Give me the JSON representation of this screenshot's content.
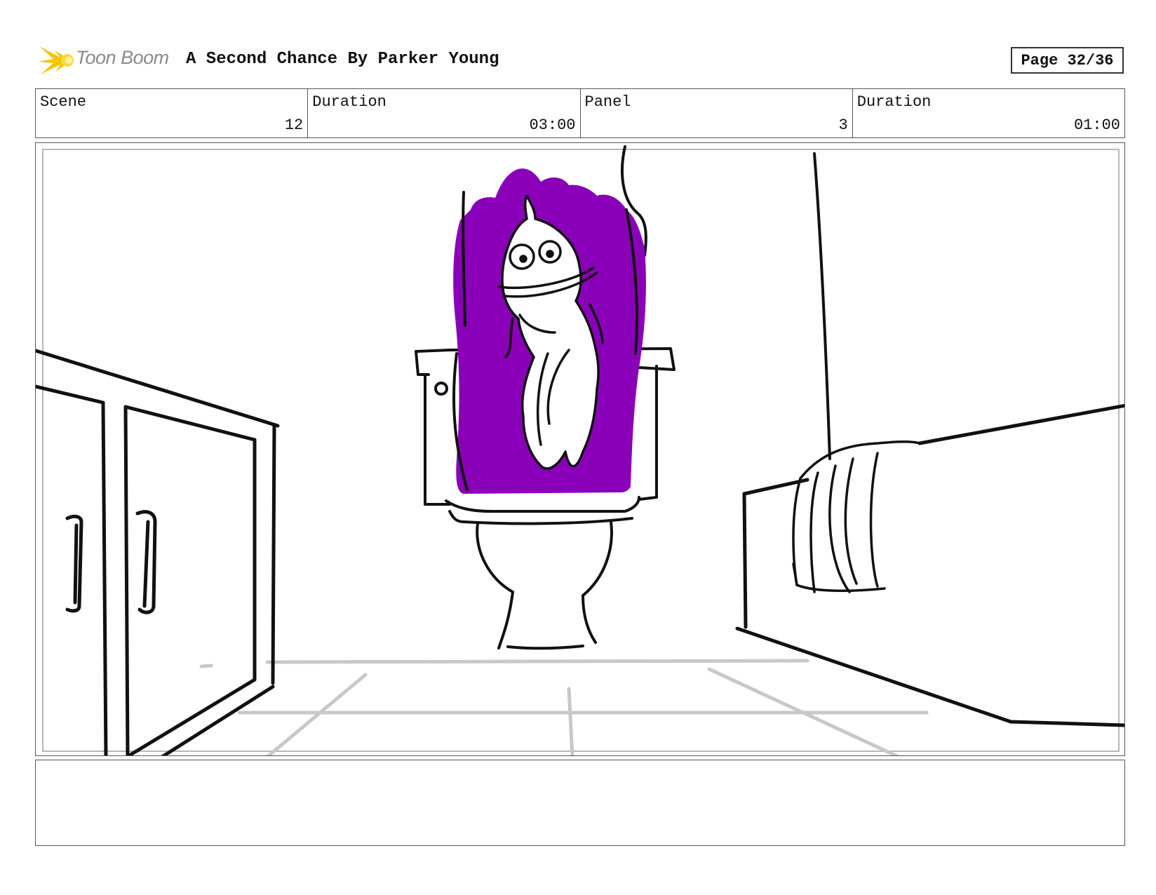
{
  "header": {
    "logo_text": "Toon Boom",
    "title": "A Second Chance  By Parker Young",
    "page": "Page 32/36"
  },
  "meta": {
    "scene_label": "Scene",
    "scene_value": "12",
    "scene_duration_label": "Duration",
    "scene_duration_value": "03:00",
    "panel_label": "Panel",
    "panel_value": "3",
    "panel_duration_label": "Duration",
    "panel_duration_value": "01:00"
  },
  "notes": {
    "text": ""
  },
  "colors": {
    "accent_purple": "#8a00b8",
    "logo_yellow": "#f5c400"
  }
}
